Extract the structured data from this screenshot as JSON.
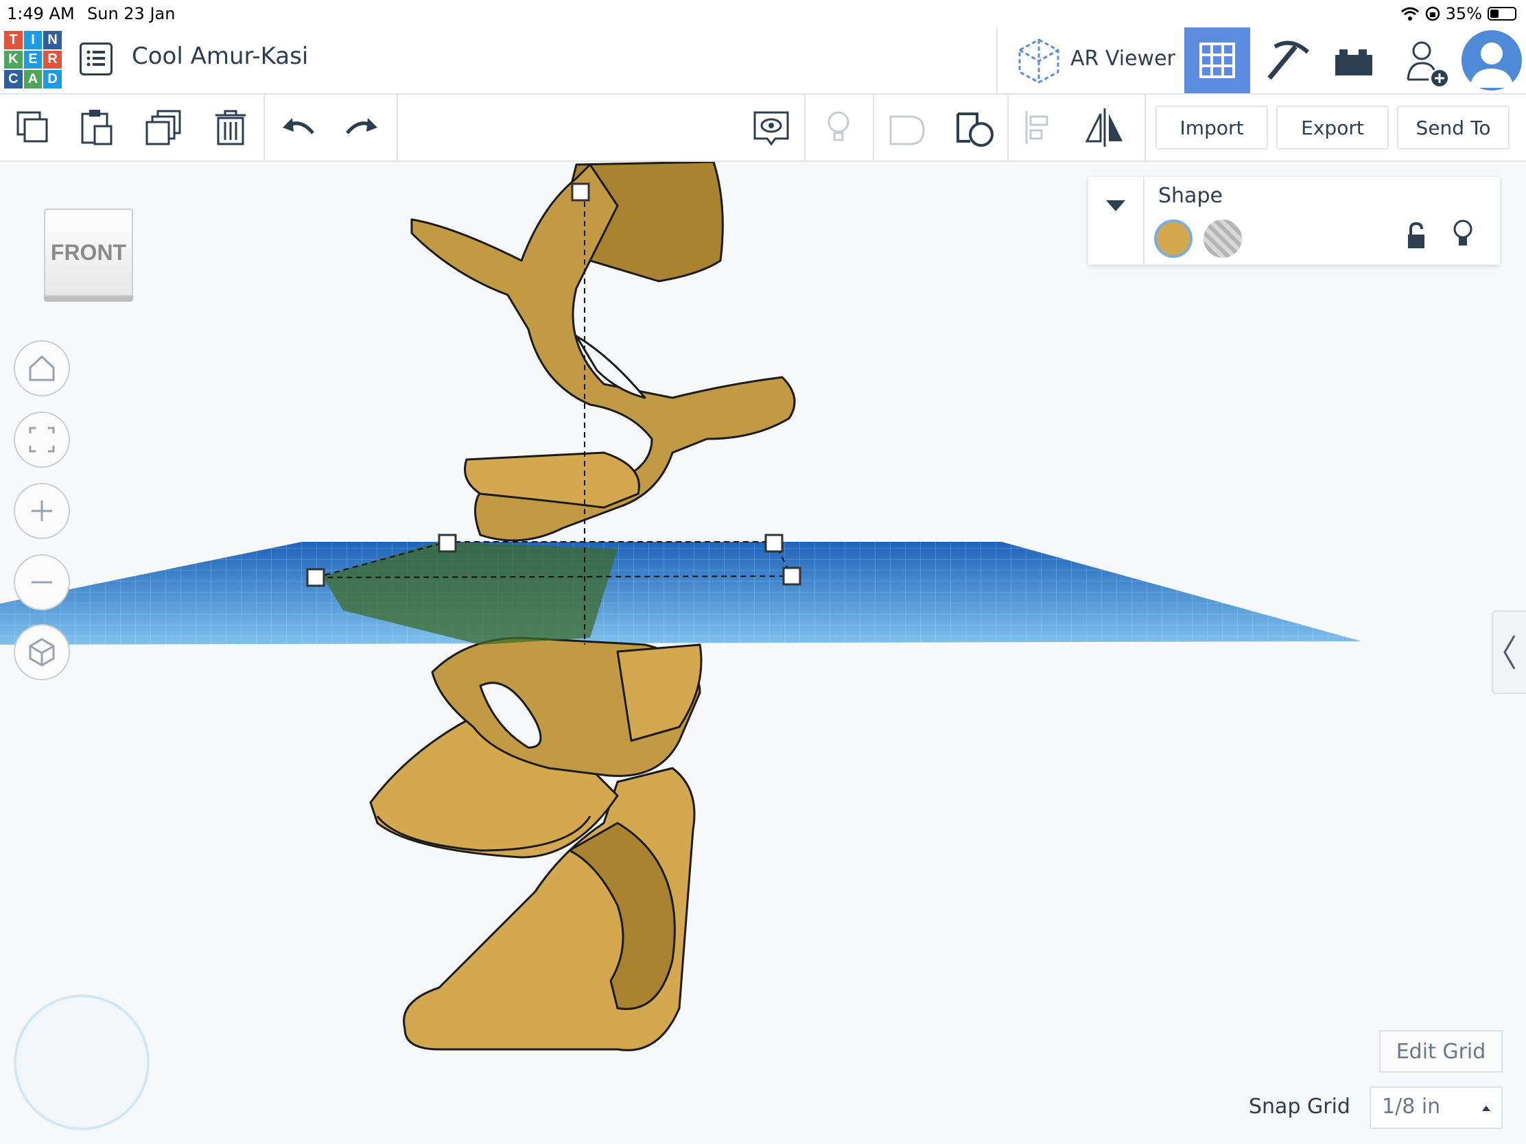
{
  "status_bar": {
    "time": "1:49 AM",
    "date": "Sun 23 Jan",
    "battery": "35%"
  },
  "app": {
    "logo_letters": [
      "T",
      "I",
      "N",
      "K",
      "E",
      "R",
      "C",
      "A",
      "D"
    ],
    "logo_colors": [
      "#e2533b",
      "#1d9ae4",
      "#2f5f9e",
      "#4fa65b",
      "#1d9ae4",
      "#e2533b",
      "#2f5f9e",
      "#4fa65b",
      "#1d9ae4"
    ],
    "design_title": "Cool Amur-Kasi"
  },
  "header": {
    "ar_viewer_label": "AR Viewer",
    "buttons": [
      "3d-design-view",
      "codeblocks",
      "bricks",
      "invite-user",
      "user-profile"
    ]
  },
  "toolbar": {
    "tools": [
      "copy",
      "paste",
      "duplicate",
      "delete",
      "undo",
      "redo",
      "notes",
      "light",
      "hole",
      "shape",
      "align",
      "mirror"
    ],
    "import_label": "Import",
    "export_label": "Export",
    "send_to_label": "Send To"
  },
  "viewcube": {
    "face_label": "FRONT"
  },
  "shape_panel": {
    "title": "Shape",
    "solid_color": "#d4a84e",
    "hole_color": "#b5b5b5"
  },
  "grid_controls": {
    "edit_grid_label": "Edit Grid",
    "snap_grid_label": "Snap Grid",
    "snap_grid_value": "1/8 in"
  }
}
